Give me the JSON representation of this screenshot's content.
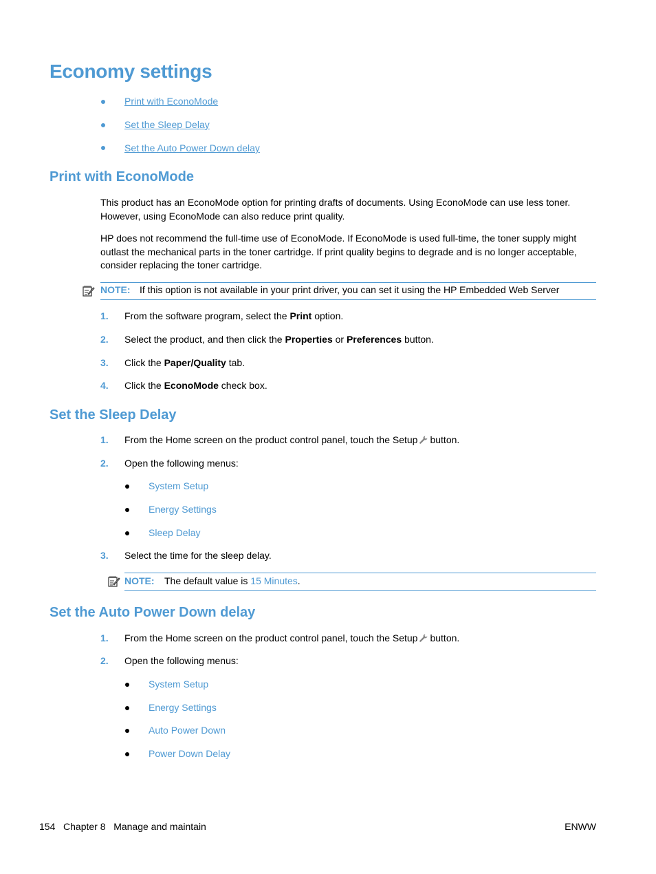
{
  "page": {
    "title": "Economy settings",
    "toc": [
      "Print with EconoMode",
      "Set the Sleep Delay",
      "Set the Auto Power Down delay"
    ]
  },
  "econo": {
    "heading": "Print with EconoMode",
    "para1": "This product has an EconoMode option for printing drafts of documents. Using EconoMode can use less toner. However, using EconoMode can also reduce print quality.",
    "para2": "HP does not recommend the full-time use of EconoMode. If EconoMode is used full-time, the toner supply might outlast the mechanical parts in the toner cartridge. If print quality begins to degrade and is no longer acceptable, consider replacing the toner cartridge.",
    "note_label": "NOTE:",
    "note_text": "If this option is not available in your print driver, you can set it using the HP Embedded Web Server",
    "steps": [
      {
        "num": "1.",
        "pre": "From the software program, select the ",
        "bold": "Print",
        "post": " option."
      },
      {
        "num": "2.",
        "pre": "Select the product, and then click the ",
        "bold": "Properties",
        "mid": " or ",
        "bold2": "Preferences",
        "post": " button."
      },
      {
        "num": "3.",
        "pre": "Click the ",
        "bold": "Paper/Quality",
        "post": " tab."
      },
      {
        "num": "4.",
        "pre": "Click the ",
        "bold": "EconoMode",
        "post": " check box."
      }
    ]
  },
  "sleep": {
    "heading": "Set the Sleep Delay",
    "step1_num": "1.",
    "step1_pre": "From the Home screen on the product control panel, touch the Setup",
    "step1_post": "button.",
    "step2_num": "2.",
    "step2": "Open the following menus:",
    "menus": [
      "System Setup",
      "Energy Settings",
      "Sleep Delay"
    ],
    "step3_num": "3.",
    "step3": "Select the time for the sleep delay.",
    "note_label": "NOTE:",
    "note_pre": "The default value is ",
    "note_value": "15 Minutes",
    "note_post": "."
  },
  "autopower": {
    "heading": "Set the Auto Power Down delay",
    "step1_num": "1.",
    "step1_pre": "From the Home screen on the product control panel, touch the Setup",
    "step1_post": "button.",
    "step2_num": "2.",
    "step2": "Open the following menus:",
    "menus": [
      "System Setup",
      "Energy Settings",
      "Auto Power Down",
      "Power Down Delay"
    ]
  },
  "footer": {
    "page_num": "154",
    "chapter": "Chapter 8",
    "chapter_title": "Manage and maintain",
    "right": "ENWW"
  },
  "icons": {
    "note": "note-pencil-icon",
    "setup": "wrench-icon"
  },
  "colors": {
    "accent": "#4f9ad3"
  }
}
